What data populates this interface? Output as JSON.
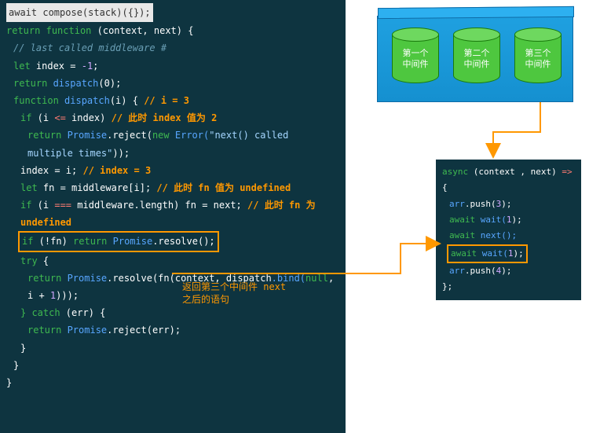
{
  "left": {
    "title": "await compose(stack)({});",
    "l1": {
      "ret": "return",
      "func": "function",
      "sig": "(context, next) {"
    },
    "l2": "// last called middleware #",
    "l3": {
      "let": "let",
      "expr": " index = ",
      "neg": "-1",
      "semi": ";"
    },
    "l4": {
      "ret": "return",
      "fn": " dispatch",
      "args": "(0);"
    },
    "l5": {
      "func": "function",
      "fn": " dispatch",
      "sig": "(i) { ",
      "ann": "// i = 3"
    },
    "l6": {
      "if": "if",
      "cond": " (i ",
      "op": "<=",
      "rest": " index) ",
      "ann": "// 此时 index 值为 2"
    },
    "l7": {
      "ret": "return",
      "prm": " Promise",
      "rej": ".reject(",
      "new": "new",
      "err": " Error(",
      "str": "\"next() called multiple times\"",
      "end": "));"
    },
    "l8": {
      "expr": "index = i;  ",
      "ann": "// index = 3"
    },
    "l9": {
      "let": "let",
      "expr": " fn = middleware[i]; ",
      "ann": "// 此时 fn 值为 undefined"
    },
    "l10": {
      "if": "if",
      "cond": " (i ",
      "op": "===",
      "rest": " middleware.length) fn = next; ",
      "ann": "// 此时 fn 为 undefined"
    },
    "l11": {
      "if": "if",
      "cond": " (!fn) ",
      "ret": "return",
      "prm": " Promise",
      "res": ".resolve();"
    },
    "l12": {
      "try": "try",
      "brace": " {"
    },
    "l13": {
      "ret": "return",
      "prm": " Promise",
      "res": ".resolve(fn(context, dispatch",
      "bind": ".bind(",
      "null": "null",
      "comma": ", i + ",
      "one": "1",
      "end": ")));"
    },
    "l14": {
      "catch": "} catch",
      "sig": " (err) {"
    },
    "l15": {
      "ret": "return",
      "prm": " Promise",
      "rej": ".reject(err);"
    },
    "l16": "}",
    "l17": "}",
    "l18": "}",
    "annotation": "返回第三个中间件 next\n之后的语句"
  },
  "box": {
    "cyl1": "第一个\n中间件",
    "cyl2": "第二个\n中间件",
    "cyl3": "第三个\n中间件"
  },
  "right": {
    "l1": {
      "async": "async",
      "sig": " (context , next) ",
      "arrow": "=>",
      "brace": " {"
    },
    "l2": {
      "obj": "arr",
      "fn": ".push(",
      "num": "3",
      "end": ");"
    },
    "l3": {
      "await": "await",
      "fn": " wait(",
      "num": "1",
      "end": ");"
    },
    "l4": {
      "await": "await",
      "fn": " next();"
    },
    "l5": {
      "await": "await",
      "fn": " wait(",
      "num": "1",
      "end": ");"
    },
    "l6": {
      "obj": "arr",
      "fn": ".push(",
      "num": "4",
      "end": ");"
    },
    "l7": "};"
  },
  "colors": {
    "background": "#0e3440",
    "highlight": "#ff9800",
    "container": "#1fa0e0",
    "cylinder": "#4ec73f"
  }
}
